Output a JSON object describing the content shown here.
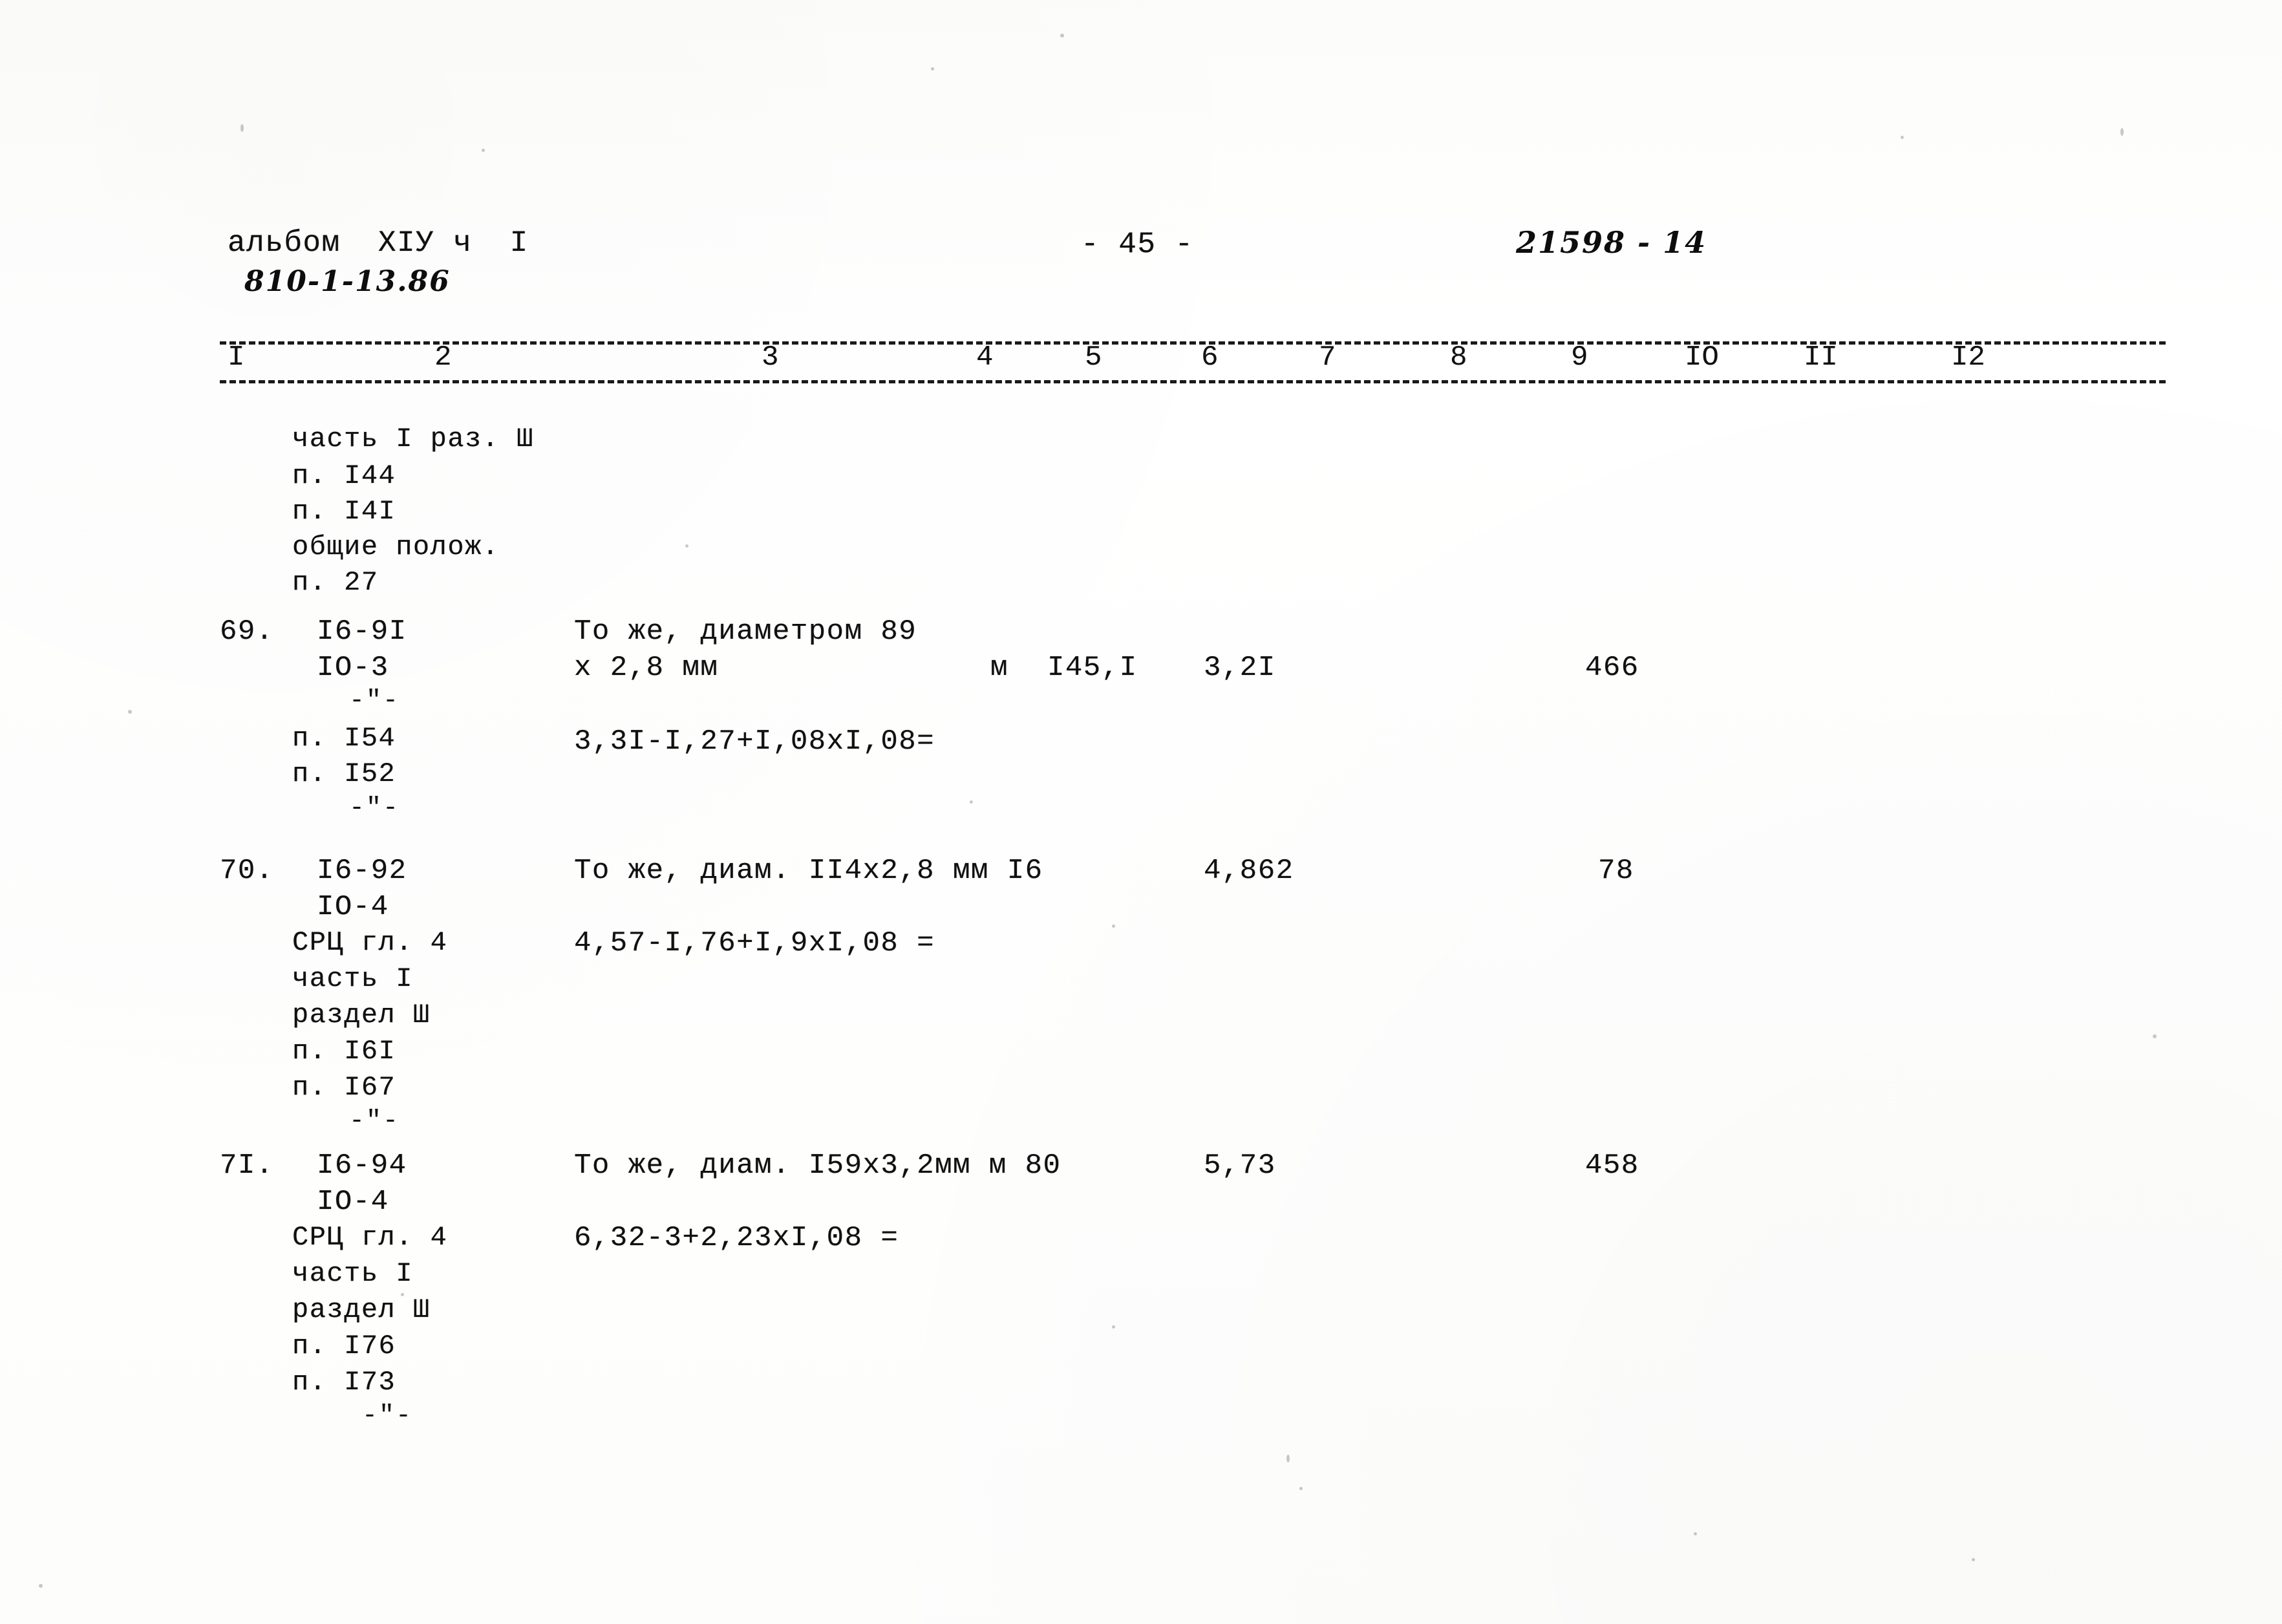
{
  "document": {
    "album_line": "альбом  XIУ ч  I",
    "album_code_handwritten": "810-1-13.86",
    "page_marker": "- 45 -",
    "doc_number_handwritten": "21598 - 14"
  },
  "column_ruler": {
    "numbers": [
      "I",
      "2",
      "3",
      "4",
      "5",
      "6",
      "7",
      "8",
      "9",
      "IO",
      "II",
      "I2"
    ]
  },
  "intro_block": {
    "lines": [
      "часть I раз. Ш",
      "п. I44",
      "п. I4I",
      "общие полож.",
      "п. 27"
    ]
  },
  "rows": [
    {
      "number": "69.",
      "code_lines": [
        "I6-9I",
        "IO-3"
      ],
      "ditto_mark": "-\"-",
      "ref_lines": [
        "п. I54",
        "п. I52"
      ],
      "ditto_mark_2": "-\"-",
      "description_line1": "То же, диаметром 89",
      "description_line2": "x 2,8 мм",
      "unit": "м",
      "quantity": "I45,I",
      "unit_price": "3,2I",
      "total": "466",
      "formula": "3,3I-I,27+I,08xI,08="
    },
    {
      "number": "70.",
      "code_lines": [
        "I6-92",
        "IO-4"
      ],
      "ref_lines": [
        "СРЦ гл. 4",
        "часть I",
        "раздел Ш",
        "п. I6I",
        "п. I67"
      ],
      "ditto_mark_2": "-\"-",
      "description_line1": "То же, диам. II4x2,8 мм I6",
      "unit_price": "4,862",
      "total": "78",
      "formula": "4,57-I,76+I,9xI,08 ="
    },
    {
      "number": "7I.",
      "code_lines": [
        "I6-94",
        "IO-4"
      ],
      "ref_lines": [
        "СРЦ гл. 4",
        "часть I",
        "раздел Ш",
        "п. I76",
        "п. I73"
      ],
      "ditto_mark_2": "-\"-",
      "description_line1": "То же, диам. I59x3,2мм м 80",
      "unit_price": "5,73",
      "total": "458",
      "formula": "6,32-3+2,23xI,08 ="
    }
  ]
}
